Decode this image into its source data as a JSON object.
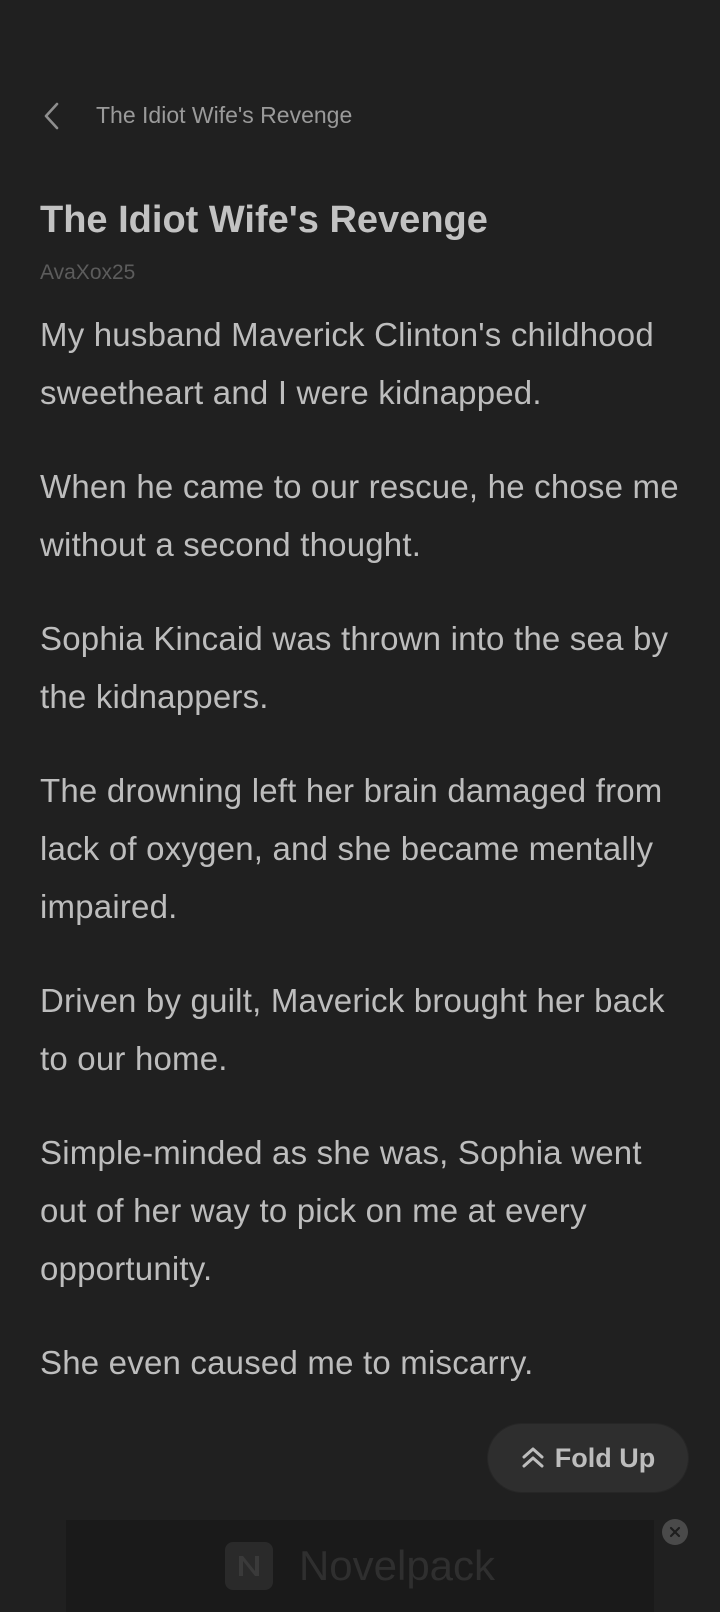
{
  "header": {
    "back_icon": "chevron-left-icon",
    "title": "The Idiot Wife's Revenge"
  },
  "book": {
    "title": "The Idiot Wife's Revenge",
    "author": "AvaXox25",
    "paragraphs": [
      "My husband Maverick Clinton's childhood sweetheart and I were kidnapped.",
      "When he came to our rescue, he chose me without a second thought.",
      "Sophia Kincaid was thrown into the sea by the kidnappers.",
      "The drowning left her brain damaged from lack of oxygen, and she became mentally impaired.",
      "Driven by guilt, Maverick brought her back to our home.",
      "Simple-minded as she was, Sophia went out of her way to pick on me at every opportunity.",
      "She even caused me to miscarry."
    ]
  },
  "fold_button": {
    "label": "Fold Up",
    "icon": "double-chevron-up-icon"
  },
  "ad": {
    "name": "Novelpack",
    "logo_icon": "novelpack-logo-icon",
    "close_icon": "close-icon"
  },
  "colors": {
    "background": "#202020",
    "text": "#bdbdbd",
    "muted": "#5c5c5c",
    "button_bg": "#2e2e2e"
  }
}
